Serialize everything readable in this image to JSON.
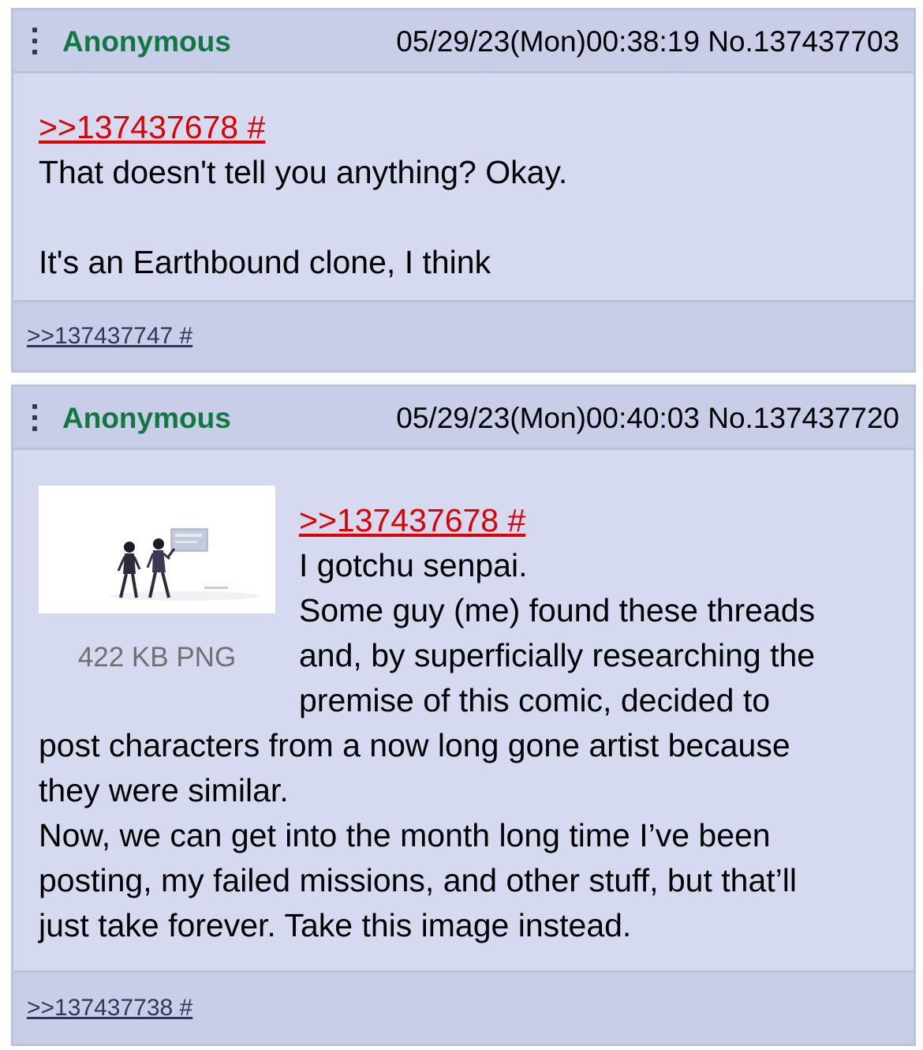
{
  "posts": [
    {
      "name": "Anonymous",
      "datetime": "05/29/23(Mon)00:38:19",
      "post_no": "No.137437703",
      "quote": ">>137437678 #",
      "lines": [
        "That doesn't tell you anything? Okay.",
        "",
        "It's an Earthbound clone, I think"
      ],
      "backlink": ">>137437747 #"
    },
    {
      "name": "Anonymous",
      "datetime": "05/29/23(Mon)00:40:03",
      "post_no": "No.137437720",
      "file_info": "422 KB PNG",
      "quote": ">>137437678 #",
      "lines_beside_image": [
        "I gotchu senpai.",
        "Some guy (me) found these threads",
        "and, by superficially researching the",
        "premise of this comic, decided to"
      ],
      "lines_full_width": [
        "post characters from a now long gone artist because",
        "they were similar.",
        "Now, we can get into the month long time I’ve been",
        "posting, my failed missions, and other stuff, but that’ll",
        "just take forever. Take this image instead."
      ],
      "backlink": ">>137437738 #"
    }
  ],
  "colors": {
    "post_bg": "#d6daf0",
    "header_bg": "#c9cee8",
    "border": "#b7c5d9",
    "name": "#117743",
    "quotelink": "#dd0000",
    "backlink": "#34345c",
    "file_info": "#707070"
  },
  "icons": {
    "menu": "vertical-ellipsis-icon"
  }
}
